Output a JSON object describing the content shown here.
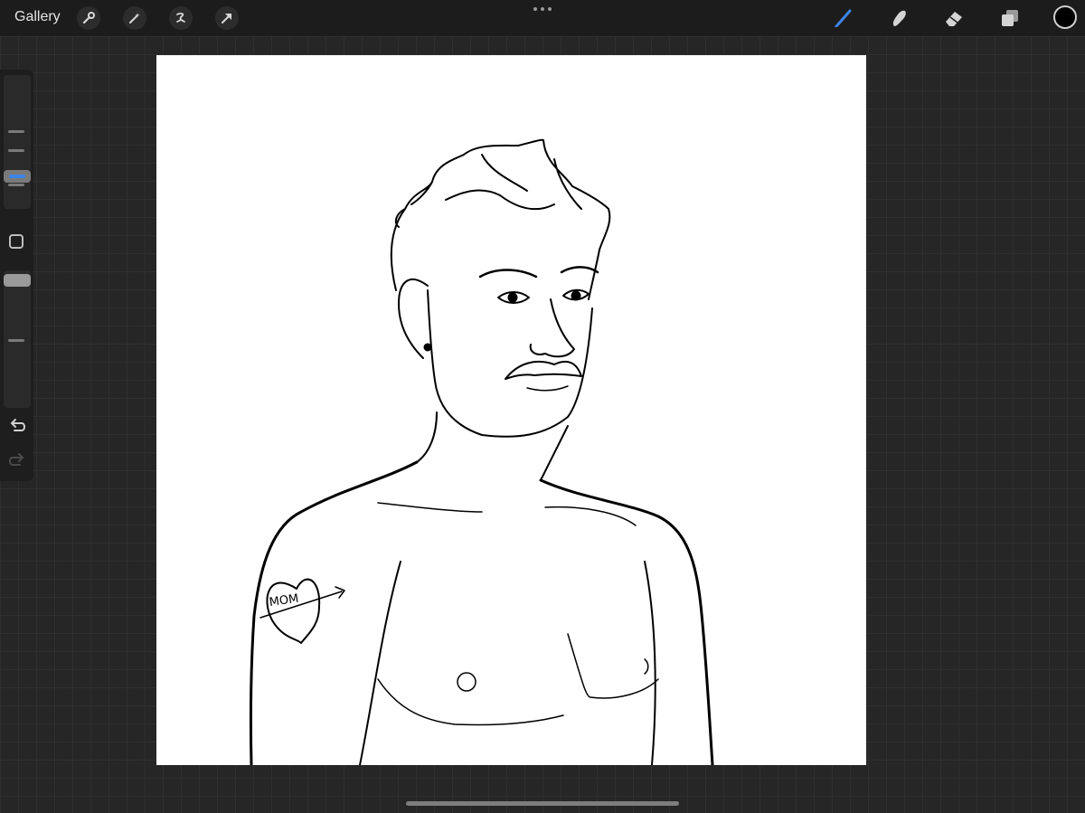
{
  "topbar": {
    "gallery_label": "Gallery",
    "left_tools": [
      "wrench-icon",
      "magic-wand-icon",
      "selection-icon",
      "transform-arrow-icon"
    ],
    "right_tools": [
      "brush-icon",
      "smudge-icon",
      "eraser-icon",
      "layers-icon"
    ],
    "active_tool": "brush-icon",
    "accent_color": "#3d84e6",
    "current_color": "#000000"
  },
  "sidebar": {
    "brush_size_slider": "brush-size-slider",
    "opacity_slider": "opacity-slider",
    "modifier_button": "modifier-square-icon",
    "undo": "undo-icon",
    "redo": "redo-icon"
  },
  "canvas": {
    "background": "#ffffff",
    "artwork": "line-art-portrait",
    "tattoo_text": "MOM"
  }
}
